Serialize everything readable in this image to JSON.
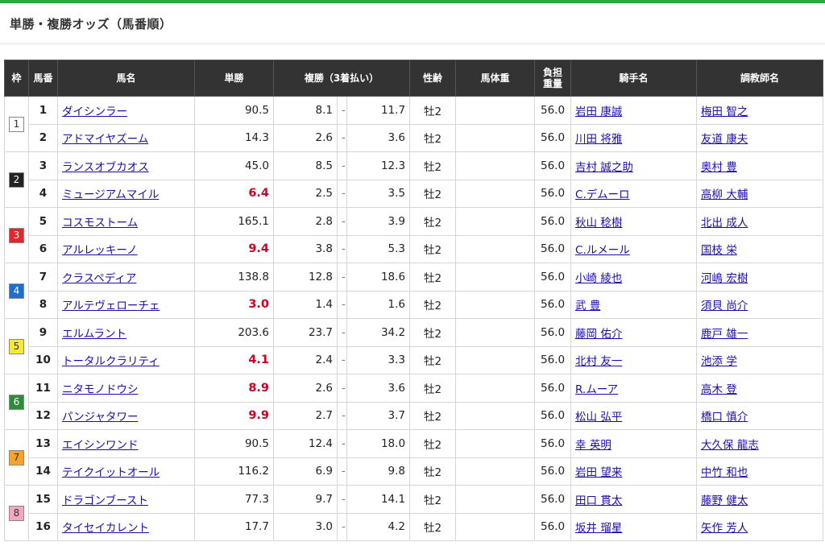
{
  "page": {
    "title": "単勝・複勝オッズ（馬番順）"
  },
  "colors": {
    "accent": "#1fae3f",
    "header_bg": "#333333",
    "favorite_text": "#cc0022",
    "link": "#1a0dab"
  },
  "table": {
    "headers": {
      "waku": "枠",
      "umaban": "馬番",
      "name": "馬名",
      "win": "単勝",
      "place": "複勝（3着払い）",
      "sex_age": "性齢",
      "body_weight": "馬体重",
      "burden_weight": [
        "負担",
        "重量"
      ],
      "jockey": "騎手名",
      "trainer": "調教師名"
    },
    "place_separator": "-",
    "waku_colors": {
      "1": {
        "bg": "#ffffff",
        "fg": "#333333"
      },
      "2": {
        "bg": "#222222",
        "fg": "#ffffff"
      },
      "3": {
        "bg": "#e2262d",
        "fg": "#ffffff"
      },
      "4": {
        "bg": "#1f6ec9",
        "fg": "#ffffff"
      },
      "5": {
        "bg": "#f6e83b",
        "fg": "#333333"
      },
      "6": {
        "bg": "#2e8b3c",
        "fg": "#ffffff"
      },
      "7": {
        "bg": "#f4a42b",
        "fg": "#333333"
      },
      "8": {
        "bg": "#f3a7c2",
        "fg": "#333333"
      }
    },
    "rows": [
      {
        "waku": "1",
        "num": "1",
        "name": "ダイシンラー",
        "win": "90.5",
        "fav": false,
        "place_lo": "8.1",
        "place_hi": "11.7",
        "sex": "牡2",
        "weight": "56.0",
        "jockey": "岩田 康誠",
        "trainer": "梅田 智之"
      },
      {
        "waku": "1",
        "num": "2",
        "name": "アドマイヤズーム",
        "win": "14.3",
        "fav": false,
        "place_lo": "2.6",
        "place_hi": "3.6",
        "sex": "牡2",
        "weight": "56.0",
        "jockey": "川田 将雅",
        "trainer": "友道 康夫"
      },
      {
        "waku": "2",
        "num": "3",
        "name": "ランスオブカオス",
        "win": "45.0",
        "fav": false,
        "place_lo": "8.5",
        "place_hi": "12.3",
        "sex": "牡2",
        "weight": "56.0",
        "jockey": "吉村 誠之助",
        "trainer": "奥村 豊"
      },
      {
        "waku": "2",
        "num": "4",
        "name": "ミュージアムマイル",
        "win": "6.4",
        "fav": true,
        "place_lo": "2.5",
        "place_hi": "3.5",
        "sex": "牡2",
        "weight": "56.0",
        "jockey": "C.デムーロ",
        "trainer": "高柳 大輔"
      },
      {
        "waku": "3",
        "num": "5",
        "name": "コスモストーム",
        "win": "165.1",
        "fav": false,
        "place_lo": "2.8",
        "place_hi": "3.9",
        "sex": "牡2",
        "weight": "56.0",
        "jockey": "秋山 稔樹",
        "trainer": "北出 成人"
      },
      {
        "waku": "3",
        "num": "6",
        "name": "アルレッキーノ",
        "win": "9.4",
        "fav": true,
        "place_lo": "3.8",
        "place_hi": "5.3",
        "sex": "牡2",
        "weight": "56.0",
        "jockey": "C.ルメール",
        "trainer": "国枝 栄"
      },
      {
        "waku": "4",
        "num": "7",
        "name": "クラスペディア",
        "win": "138.8",
        "fav": false,
        "place_lo": "12.8",
        "place_hi": "18.6",
        "sex": "牡2",
        "weight": "56.0",
        "jockey": "小崎 綾也",
        "trainer": "河嶋 宏樹"
      },
      {
        "waku": "4",
        "num": "8",
        "name": "アルテヴェローチェ",
        "win": "3.0",
        "fav": true,
        "place_lo": "1.4",
        "place_hi": "1.6",
        "sex": "牡2",
        "weight": "56.0",
        "jockey": "武 豊",
        "trainer": "須貝 尚介"
      },
      {
        "waku": "5",
        "num": "9",
        "name": "エルムラント",
        "win": "203.6",
        "fav": false,
        "place_lo": "23.7",
        "place_hi": "34.2",
        "sex": "牡2",
        "weight": "56.0",
        "jockey": "藤岡 佑介",
        "trainer": "鹿戸 雄一"
      },
      {
        "waku": "5",
        "num": "10",
        "name": "トータルクラリティ",
        "win": "4.1",
        "fav": true,
        "place_lo": "2.4",
        "place_hi": "3.3",
        "sex": "牡2",
        "weight": "56.0",
        "jockey": "北村 友一",
        "trainer": "池添 学"
      },
      {
        "waku": "6",
        "num": "11",
        "name": "ニタモノドウシ",
        "win": "8.9",
        "fav": true,
        "place_lo": "2.6",
        "place_hi": "3.6",
        "sex": "牡2",
        "weight": "56.0",
        "jockey": "R.ムーア",
        "trainer": "高木 登"
      },
      {
        "waku": "6",
        "num": "12",
        "name": "パンジャタワー",
        "win": "9.9",
        "fav": true,
        "place_lo": "2.7",
        "place_hi": "3.7",
        "sex": "牡2",
        "weight": "56.0",
        "jockey": "松山 弘平",
        "trainer": "橋口 慎介"
      },
      {
        "waku": "7",
        "num": "13",
        "name": "エイシンワンド",
        "win": "90.5",
        "fav": false,
        "place_lo": "12.4",
        "place_hi": "18.0",
        "sex": "牡2",
        "weight": "56.0",
        "jockey": "幸 英明",
        "trainer": "大久保 龍志"
      },
      {
        "waku": "7",
        "num": "14",
        "name": "テイクイットオール",
        "win": "116.2",
        "fav": false,
        "place_lo": "6.9",
        "place_hi": "9.8",
        "sex": "牡2",
        "weight": "56.0",
        "jockey": "岩田 望来",
        "trainer": "中竹 和也"
      },
      {
        "waku": "8",
        "num": "15",
        "name": "ドラゴンブースト",
        "win": "77.3",
        "fav": false,
        "place_lo": "9.7",
        "place_hi": "14.1",
        "sex": "牡2",
        "weight": "56.0",
        "jockey": "田口 貫太",
        "trainer": "藤野 健太"
      },
      {
        "waku": "8",
        "num": "16",
        "name": "タイセイカレント",
        "win": "17.7",
        "fav": false,
        "place_lo": "3.0",
        "place_hi": "4.2",
        "sex": "牡2",
        "weight": "56.0",
        "jockey": "坂井 瑠星",
        "trainer": "矢作 芳人"
      }
    ]
  }
}
